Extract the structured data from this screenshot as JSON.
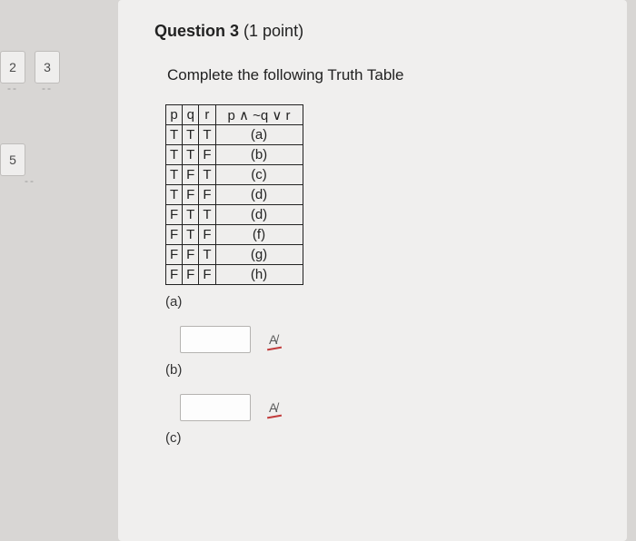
{
  "nav": {
    "items": [
      "2",
      "3",
      "5"
    ]
  },
  "question": {
    "label": "Question 3",
    "points": "(1 point)",
    "instruction": "Complete the following Truth Table"
  },
  "table": {
    "headers": [
      "p",
      "q",
      "r",
      "p ∧ ~q ∨ r"
    ],
    "rows": [
      {
        "p": "T",
        "q": "T",
        "r": "T",
        "val": "(a)"
      },
      {
        "p": "T",
        "q": "T",
        "r": "F",
        "val": "(b)"
      },
      {
        "p": "T",
        "q": "F",
        "r": "T",
        "val": "(c)"
      },
      {
        "p": "T",
        "q": "F",
        "r": "F",
        "val": "(d)"
      },
      {
        "p": "F",
        "q": "T",
        "r": "T",
        "val": "(d)"
      },
      {
        "p": "F",
        "q": "T",
        "r": "F",
        "val": "(f)"
      },
      {
        "p": "F",
        "q": "F",
        "r": "T",
        "val": "(g)"
      },
      {
        "p": "F",
        "q": "F",
        "r": "F",
        "val": "(h)"
      }
    ]
  },
  "answers": {
    "labels": [
      "(a)",
      "(b)",
      "(c)"
    ],
    "icon_text": "A̸"
  }
}
